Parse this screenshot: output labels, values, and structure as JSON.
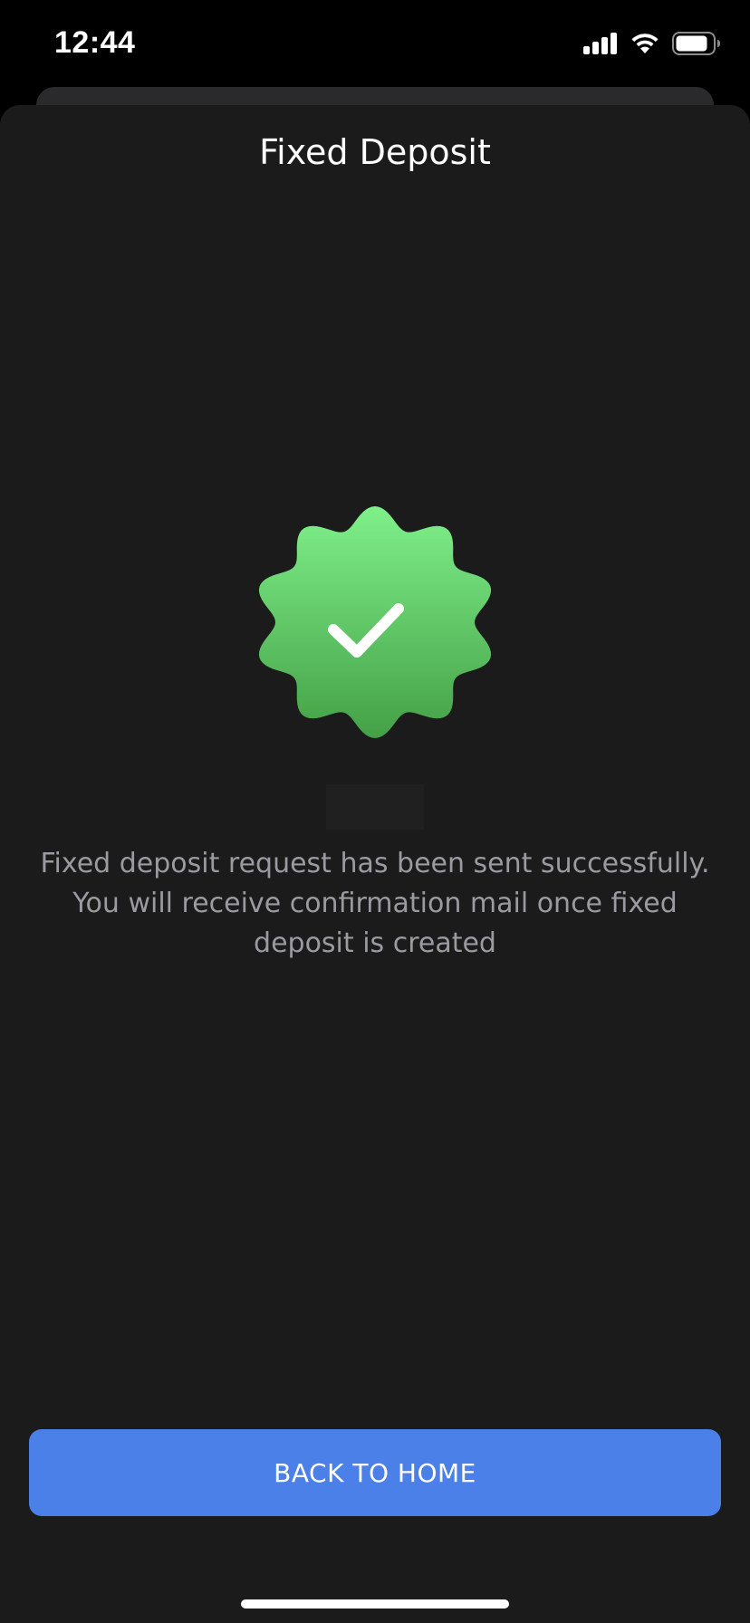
{
  "status_bar": {
    "time": "12:44",
    "icons": [
      "cellular-signal-icon",
      "wifi-icon",
      "battery-icon"
    ]
  },
  "header": {
    "title": "Fixed Deposit"
  },
  "success": {
    "icon": "success-badge-check-icon",
    "message": "Fixed deposit request has been sent successfully. You will receive confirmation mail once fixed deposit is created"
  },
  "actions": {
    "back_to_home_label": "BACK TO HOME"
  },
  "colors": {
    "background": "#1b1b1b",
    "badge_top": "#7ff08a",
    "badge_bottom": "#44a046",
    "button": "#4a80e8",
    "message_text": "#9a9aa0"
  }
}
